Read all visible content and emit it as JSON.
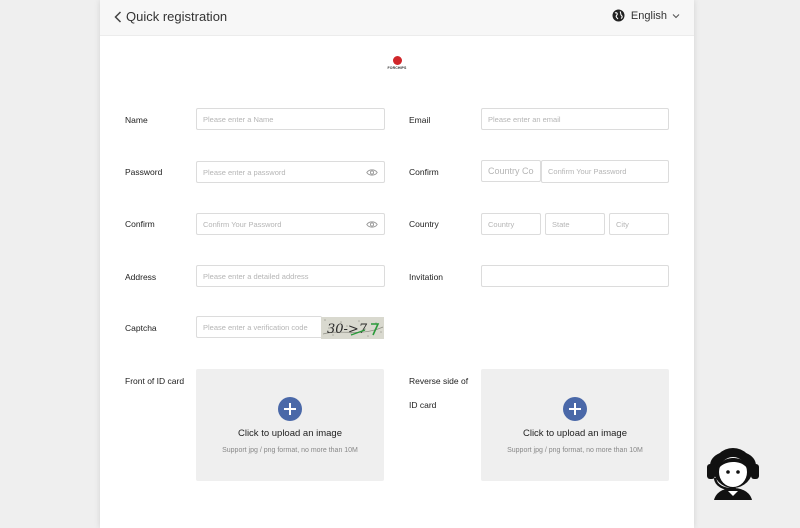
{
  "header": {
    "back_label": "Quick registration",
    "language": "English"
  },
  "logo": {
    "text": "FORCHIPS"
  },
  "form": {
    "name": {
      "label": "Name",
      "placeholder": "Please enter a Name"
    },
    "email": {
      "label": "Email",
      "placeholder": "Please enter an email"
    },
    "password": {
      "label": "Password",
      "placeholder": "Please enter a password"
    },
    "confirm_phone": {
      "label": "Confirm",
      "country_code_placeholder": "Country Cod",
      "placeholder": "Confirm Your Password"
    },
    "confirm_password": {
      "label": "Confirm",
      "placeholder": "Confirm Your Password"
    },
    "country": {
      "label": "Country",
      "country_placeholder": "Country",
      "state_placeholder": "State",
      "city_placeholder": "City"
    },
    "address": {
      "label": "Address",
      "placeholder": "Please enter a detailed address"
    },
    "invitation": {
      "label": "Invitation",
      "placeholder": ""
    },
    "captcha": {
      "label": "Captcha",
      "placeholder": "Please enter a verification code",
      "image_text": "30->7"
    },
    "front_id": {
      "label": "Front of ID card"
    },
    "reverse_id": {
      "label_line1": "Reverse side of",
      "label_line2": "ID card"
    },
    "upload": {
      "title": "Click to upload an image",
      "hint": "Support jpg / png format, no more than 10M"
    }
  },
  "colors": {
    "accent": "#4a68a8",
    "logo_red": "#d0262a",
    "upload_bg": "#efefef"
  },
  "icons": [
    "chevron-left-icon",
    "globe-icon",
    "chevron-down-icon",
    "eye-icon",
    "plus-icon",
    "customer-support-icon"
  ]
}
